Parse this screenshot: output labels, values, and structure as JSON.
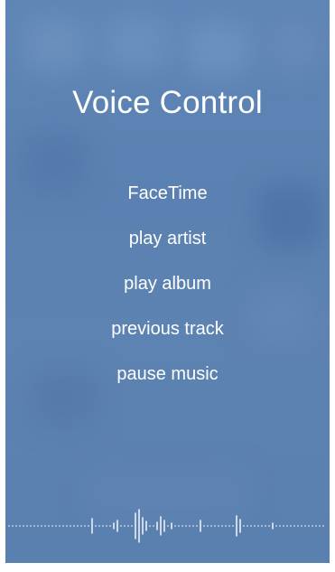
{
  "screen": {
    "title": "Voice Control",
    "commands": [
      {
        "label": "FaceTime"
      },
      {
        "label": "play artist"
      },
      {
        "label": "play album"
      },
      {
        "label": "previous track"
      },
      {
        "label": "pause music"
      }
    ]
  },
  "colors": {
    "background": "#5b82b2",
    "text": "#ffffff",
    "page": "#ffffff"
  },
  "waveform": {
    "icon": "audio-waveform",
    "state": "listening"
  }
}
